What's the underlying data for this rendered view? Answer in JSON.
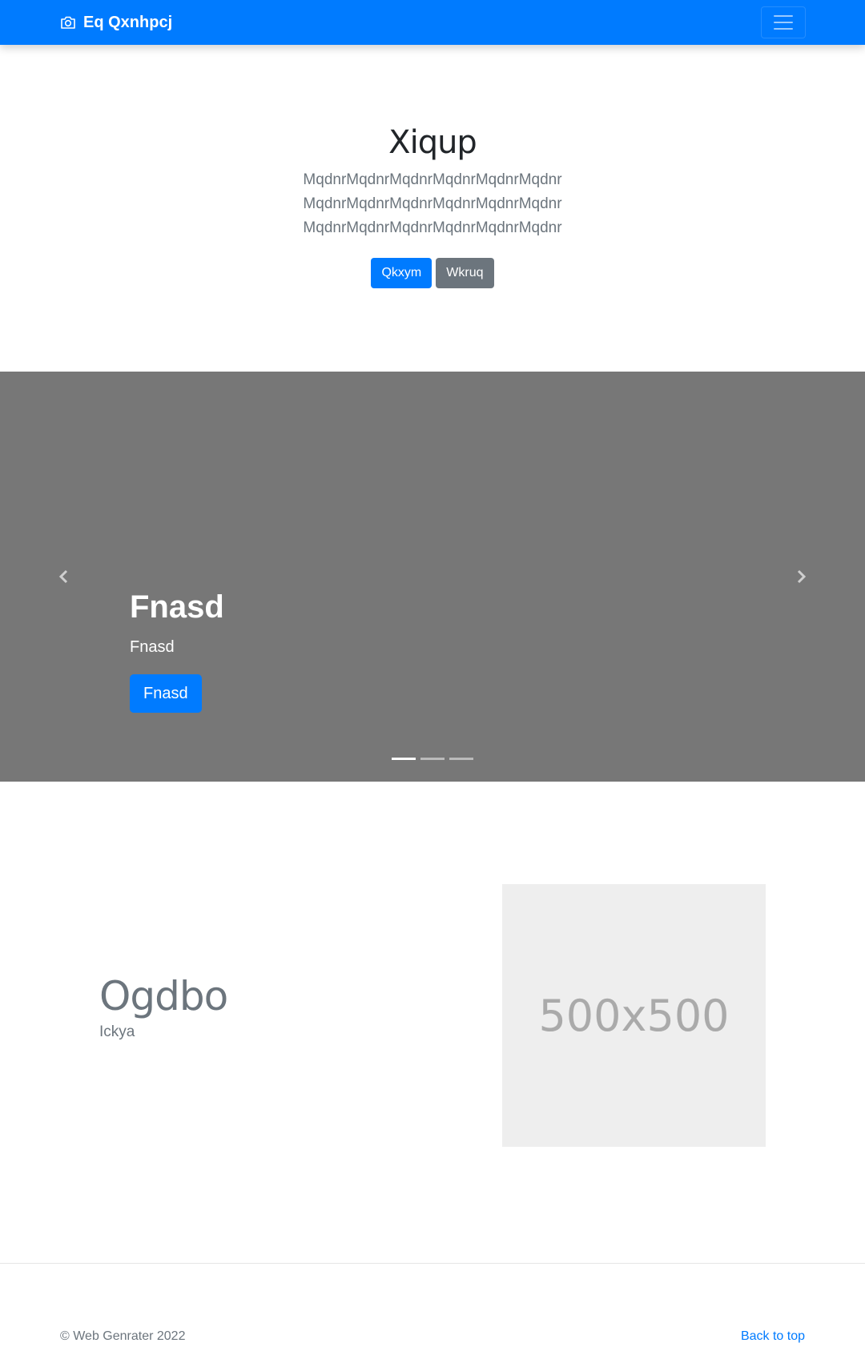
{
  "navbar": {
    "brand": "Eq Qxnhpcj",
    "brand_icon": "camera-icon",
    "toggler_icon": "hamburger-icon",
    "color": "#007bff"
  },
  "hero": {
    "title": "Xiqup",
    "lines": [
      "MqdnrMqdnrMqdnrMqdnrMqdnrMqdnr",
      "MqdnrMqdnrMqdnrMqdnrMqdnrMqdnr",
      "MqdnrMqdnrMqdnrMqdnrMqdnrMqdnr"
    ],
    "primary_button": "Qkxym",
    "secondary_button": "Wkruq"
  },
  "carousel": {
    "caption_title": "Fnasd",
    "caption_text": "Fnasd",
    "caption_button": "Fnasd",
    "prev_icon": "chevron-left-icon",
    "next_icon": "chevron-right-icon",
    "slide_count": 3,
    "active_index": 0,
    "background": "#777777"
  },
  "feature": {
    "heading": "Ogdbo",
    "subheading": "Ickya",
    "image_label": "500x500"
  },
  "footer": {
    "copyright": "© Web Genrater 2022",
    "back_to_top": "Back to top"
  }
}
